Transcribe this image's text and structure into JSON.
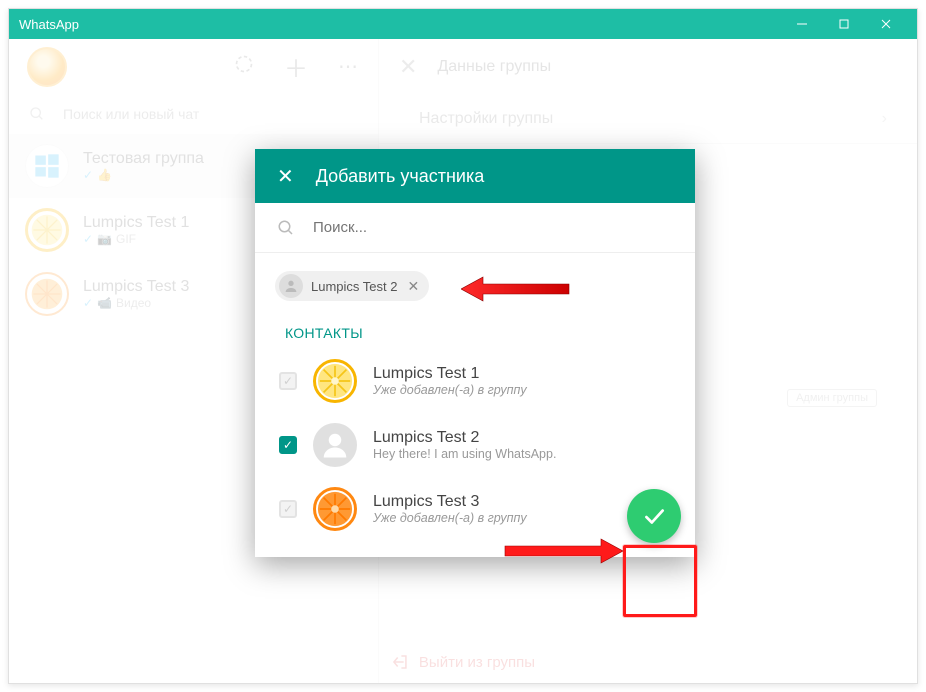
{
  "window": {
    "title": "WhatsApp"
  },
  "sidebar": {
    "search_placeholder": "Поиск или новый чат",
    "chats": [
      {
        "title": "Тестовая группа",
        "subtitle": "👍"
      },
      {
        "title": "Lumpics Test 1",
        "subtitle": "GIF"
      },
      {
        "title": "Lumpics Test 3",
        "subtitle": "Видео"
      }
    ]
  },
  "panel": {
    "title": "Данные группы",
    "settings": "Настройки группы",
    "admin_badge": "Админ группы",
    "exit": "Выйти из группы"
  },
  "modal": {
    "title": "Добавить участника",
    "search_placeholder": "Поиск...",
    "chip": {
      "name": "Lumpics Test 2"
    },
    "section": "КОНТАКТЫ",
    "contacts": [
      {
        "name": "Lumpics Test 1",
        "desc": "Уже добавлен(-а) в группу"
      },
      {
        "name": "Lumpics Test 2",
        "desc": "Hey there! I am using WhatsApp."
      },
      {
        "name": "Lumpics Test 3",
        "desc": "Уже добавлен(-а) в группу"
      }
    ]
  }
}
